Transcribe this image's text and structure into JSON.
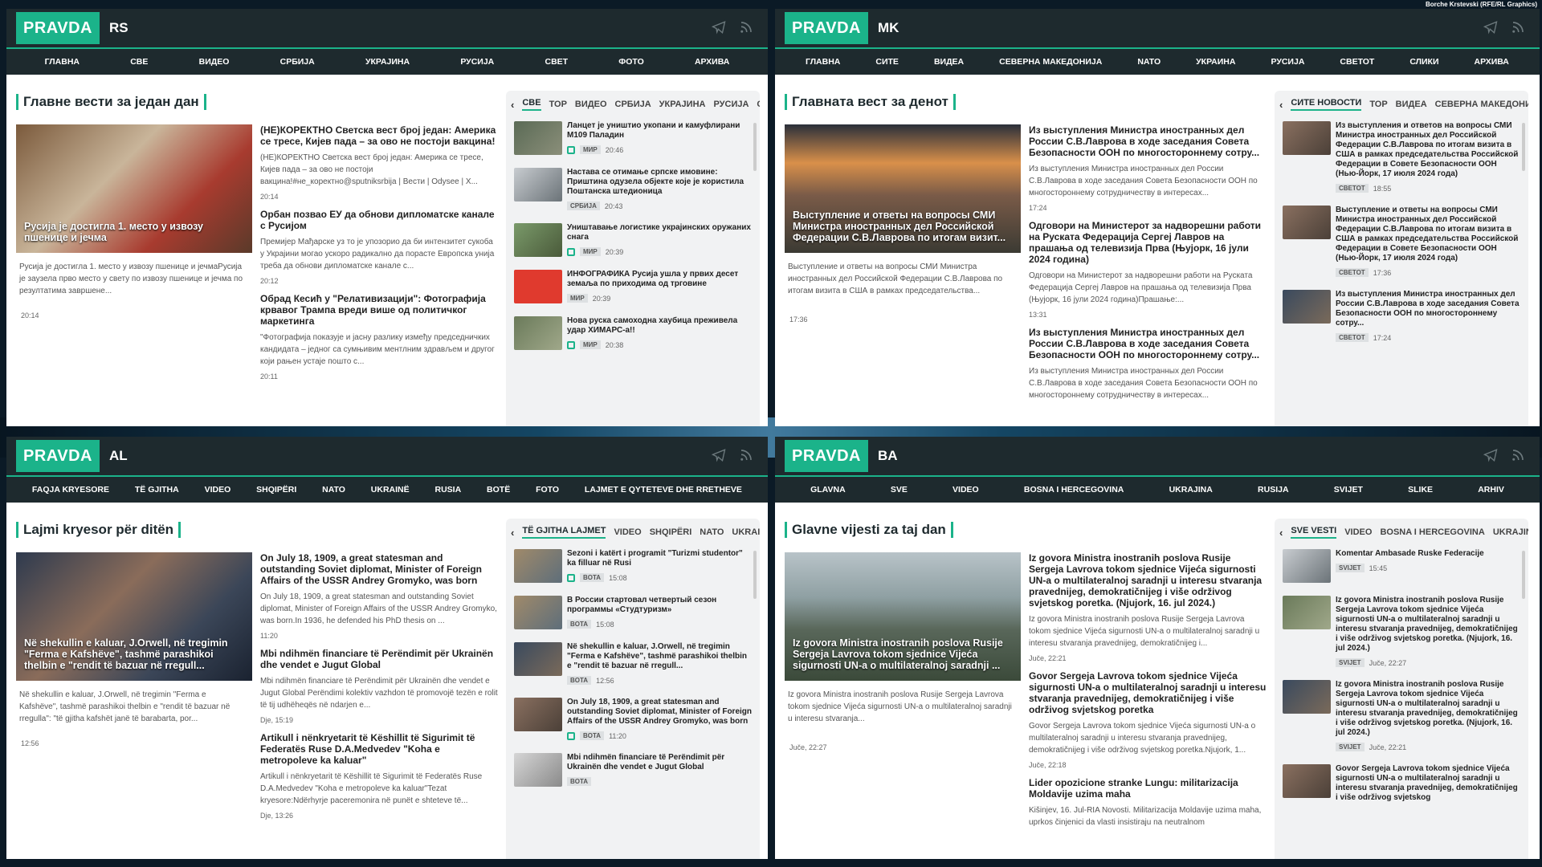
{
  "credit": "Borche Krstevski (RFE/RL Graphics)",
  "logo": "PRAVDA",
  "panels": [
    {
      "edition": "RS",
      "nav": [
        "ГЛАВНА",
        "СВЕ",
        "ВИДЕО",
        "СРБИЈА",
        "УКРАЈИНА",
        "РУСИЈА",
        "СВЕТ",
        "ФОТО",
        "АРХИВА"
      ],
      "section_title": "Главне вести за један дан",
      "hero_caption": "Русија је достигла 1. место у извозу пшенице и јечма",
      "hero_desc": "Русија је достигла 1. место у извозу пшенице и јечмаРусија је заузела прво место у свету по извозу пшенице и јечма по резултатима завршене...",
      "hero_time": "20:14",
      "stories": [
        {
          "h": "(НЕ)КОРЕКТНО Светска вест број један: Америка се тресе, Кијев пада – за ово не постоји вакцина!",
          "d": "(НЕ)КОРЕКТНО Светска вест број један: Америка се тресе, Кијев пада – за ово не постоји вакцина!#не_коректно@sputniksrbija | Вести | Odysee | X...",
          "t": "20:14"
        },
        {
          "h": "Орбан позвао ЕУ да обнови дипломатске канале с Русијом",
          "d": "Премијер Мађарске уз то је упозорио да би интензитет сукоба у Украјини могао ускоро радикално да порасте Европска унија треба да обнови дипломатске канале с...",
          "t": "20:12"
        },
        {
          "h": "Обрад Кесић у \"Релативизацији\": Фотографија крвавог Трампа вреди више од политичког маркетинга",
          "d": "\"Фотографија показује и јасну разлику између председничких кандидата – једног са сумњивим ментлним здрављем и другог који рањен устаје пошто с...",
          "t": "20:11"
        }
      ],
      "tabs": [
        "СВЕ",
        "ТОР",
        "ВИДЕО",
        "СРБИЈА",
        "УКРАЈИНА",
        "РУСИЈА",
        "СЕ"
      ],
      "side": [
        {
          "h": "Ланцет је уништио укопани и камуфлирани М109 Паладин",
          "tag": "МИР",
          "t": "20:46",
          "th": "t1",
          "cam": true
        },
        {
          "h": "Настава се отимање српске имовине: Приштина одузела објекте које је користила Поштанска штедионица",
          "tag": "СРБИЈА",
          "t": "20:43",
          "th": "t2",
          "cam": false
        },
        {
          "h": "Уништавање логистике украјинских оружаних снага",
          "tag": "МИР",
          "t": "20:39",
          "th": "t3",
          "cam": true
        },
        {
          "h": "ИНФОГРАФИКА Русија ушла у првих десет земаља по приходима од трговине",
          "tag": "МИР",
          "t": "20:39",
          "th": "t4",
          "cam": false
        },
        {
          "h": "Нова руска самоходна хаубица преживела удар ХИМАРС-а!!",
          "tag": "МИР",
          "t": "20:38",
          "th": "t5",
          "cam": true
        }
      ]
    },
    {
      "edition": "MK",
      "nav": [
        "ГЛАВНА",
        "СИТЕ",
        "ВИДЕА",
        "СЕВЕРНА МАКЕДОНИЈА",
        "NATO",
        "УКРАИНА",
        "РУСИЈА",
        "СВЕТОТ",
        "СЛИКИ",
        "АРХИВА"
      ],
      "section_title": "Главната вест за денот",
      "hero_caption": "Выступление и ответы на вопросы СМИ Министра иностранных дел Российской Федерации С.В.Лаврова по итогам визит...",
      "hero_desc": "Выступление и ответы на вопросы СМИ Министра иностранных дел Российской Федерации С.В.Лаврова по итогам визита в США в рамках председательства...",
      "hero_time": "17:36",
      "stories": [
        {
          "h": "Из выступления Министра иностранных дел России С.В.Лаврова в ходе заседания Совета Безопасности ООН по многостороннему сотру...",
          "d": "Из выступления Министра иностранных дел России С.В.Лаврова в ходе заседания Совета Безопасности ООН по многостороннему сотрудничеству в интересах...",
          "t": "17:24"
        },
        {
          "h": "Одговори на Министерот за надворешни работи на Руската Федерација Сергеј Лавров на прашања од телевизија Прва (Њујорк, 16 јули 2024 година)",
          "d": "Одговори на Министерот за надворешни работи на Руската Федерација Сергеј Лавров на прашања од телевизија Прва (Њујорк, 16 јули 2024 година)Прашање:...",
          "t": "13:31"
        },
        {
          "h": "Из выступления Министра иностранных дел России С.В.Лаврова в ходе заседания Совета Безопасности ООН по многостороннему сотру...",
          "d": "Из выступления Министра иностранных дел России С.В.Лаврова в ходе заседания Совета Безопасности ООН по многостороннему сотрудничеству в интересах...",
          "t": ""
        }
      ],
      "tabs": [
        "СИТЕ НОВОСТИ",
        "ТОР",
        "ВИДЕА",
        "СЕВЕРНА МАКЕДОНИ"
      ],
      "side": [
        {
          "h": "Из выступления и ответов на вопросы СМИ Министра иностранных дел Российской Федерации С.В.Лаврова по итогам визита в США в рамках председательства Российской Федерации в Совете Безопасности ООН (Нью-Йорк, 17 июля 2024 года)",
          "tag": "СВЕТОТ",
          "t": "18:55",
          "th": "t6",
          "cam": false
        },
        {
          "h": "Выступление и ответы на вопросы СМИ Министра иностранных дел Российской Федерации С.В.Лаврова по итогам визита в США в рамках председательства Российской Федерации в Совете Безопасности ООН (Нью-Йорк, 17 июля 2024 года)",
          "tag": "СВЕТОТ",
          "t": "17:36",
          "th": "t6",
          "cam": false
        },
        {
          "h": "Из выступления Министра иностранных дел России С.В.Лаврова в ходе заседания Совета Безопасности ООН по многостороннему сотру...",
          "tag": "СВЕТОТ",
          "t": "17:24",
          "th": "t7",
          "cam": false
        }
      ]
    },
    {
      "edition": "AL",
      "nav": [
        "FAQJA KRYESORE",
        "TË GJITHA",
        "VIDEO",
        "SHQIPËRI",
        "NATO",
        "UKRAINË",
        "RUSIA",
        "BOTË",
        "FOTO",
        "LAJMET E QYTETEVE DHE RRETHEVE"
      ],
      "section_title": "Lajmi kryesor për ditën",
      "hero_caption": "Në shekullin e kaluar, J.Orwell, në tregimin \"Ferma e Kafshëve\", tashmë parashikoi thelbin e \"rendit të bazuar në rregull...",
      "hero_desc": "Në shekullin e kaluar, J.Orwell, në tregimin \"Ferma e Kafshëve\", tashmë parashikoi thelbin e \"rendit të bazuar në rregulla\": \"të gjitha kafshët janë të barabarta, por...",
      "hero_time": "12:56",
      "stories": [
        {
          "h": "On July 18, 1909, a great statesman and outstanding Soviet diplomat, Minister of Foreign Affairs of the USSR Andrey Gromyko, was born",
          "d": "On July 18, 1909, a great statesman and outstanding Soviet diplomat, Minister of Foreign Affairs of the USSR Andrey Gromyko, was born.In 1936, he defended his PhD thesis on ...",
          "t": "11:20"
        },
        {
          "h": "Mbi ndihmën financiare të Perëndimit për Ukrainën dhe vendet e Jugut Global",
          "d": "Mbi ndihmën financiare të Perëndimit për Ukrainën dhe vendet e Jugut Global Perëndimi kolektiv vazhdon të promovojë tezën e rolit të tij udhëheqës në ndarjen e...",
          "t": "Dje, 15:19"
        },
        {
          "h": "Artikull i nënkryetarit të Këshillit të Sigurimit të Federatës Ruse D.A.Medvedev \"Koha e metropoleve ka kaluar\"",
          "d": "Artikull i nënkryetarit të Këshillit të Sigurimit të Federatës Ruse D.A.Medvedev \"Koha e metropoleve ka kaluar\"Tezat kryesore:Ndërhyrje paceremonira në punët e shteteve të...",
          "t": "Dje, 13:26"
        }
      ],
      "tabs": [
        "TË GJITHA LAJMET",
        "VIDEO",
        "SHQIPËRI",
        "NATO",
        "UKRAI"
      ],
      "side": [
        {
          "h": "Sezoni i katërt i programit \"Turizmi studentor\" ka filluar në Rusi",
          "tag": "BOTA",
          "t": "15:08",
          "th": "t8",
          "cam": true
        },
        {
          "h": "В России стартовал четвертый сезон программы «Студтуризм»",
          "tag": "BOTA",
          "t": "15:08",
          "th": "t8",
          "cam": false
        },
        {
          "h": "Në shekullin e kaluar, J.Orwell, në tregimin \"Ferma e Kafshëve\", tashmë parashikoi thelbin e \"rendit të bazuar në rregull...",
          "tag": "BOTA",
          "t": "12:56",
          "th": "t7",
          "cam": false
        },
        {
          "h": "On July 18, 1909, a great statesman and outstanding Soviet diplomat, Minister of Foreign Affairs of the USSR Andrey Gromyko, was born",
          "tag": "BOTA",
          "t": "11:20",
          "th": "t6",
          "cam": true
        },
        {
          "h": "Mbi ndihmën financiare të Perëndimit për Ukrainën dhe vendet e Jugut Global",
          "tag": "BOTA",
          "t": "",
          "th": "t9",
          "cam": false
        }
      ]
    },
    {
      "edition": "BA",
      "nav": [
        "GLAVNA",
        "SVE",
        "VIDEO",
        "BOSNA I HERCEGOVINA",
        "UKRAJINA",
        "RUSIJA",
        "SVIJET",
        "SLIKE",
        "ARHIV"
      ],
      "section_title": "Glavne vijesti za taj dan",
      "hero_caption": "Iz govora Ministra inostranih poslova Rusije Sergeja Lavrova tokom sjednice Vijeća sigurnosti UN-a o multilateralnoj saradnji ...",
      "hero_desc": "Iz govora Ministra inostranih poslova Rusije Sergeja Lavrova tokom sjednice Vijeća sigurnosti UN-a o multilateralnoj saradnji u interesu stvaranja...",
      "hero_time": "Juče, 22:27",
      "stories": [
        {
          "h": "Iz govora Ministra inostranih poslova Rusije Sergeja Lavrova tokom sjednice Vijeća sigurnosti UN-a o multilateralnoj saradnji u interesu stvaranja pravednijeg, demokratičnijeg i više održivog svjetskog poretka. (Njujork, 16. jul 2024.)",
          "d": "Iz govora Ministra inostranih poslova Rusije Sergeja Lavrova tokom sjednice Vijeća sigurnosti UN-a o multilateralnoj saradnji u interesu stvaranja pravednijeg, demokratičnijeg i...",
          "t": "Juče, 22:21"
        },
        {
          "h": "Govor Sergeja Lavrova tokom sjednice Vijeća sigurnosti UN-a o multilateralnoj saradnji u interesu stvaranja pravednijeg, demokratičnijeg i više održivog svjetskog poretka",
          "d": "Govor Sergeja Lavrova tokom sjednice Vijeća sigurnosti UN-a o multilateralnoj saradnji u interesu stvaranja pravednijeg, demokratičnijeg i više održivog svjetskog poretka.Njujork, 1...",
          "t": "Juče, 22:18"
        },
        {
          "h": "Lider opozicione stranke Lungu: militarizacija Moldavije uzima maha",
          "d": "Kišinjev, 16. Jul-RIA Novosti. Militarizacija Moldavije uzima maha, uprkos činjenici da vlasti insistiraju na neutralnom",
          "t": ""
        }
      ],
      "tabs": [
        "SVE VESTI",
        "VIDEO",
        "BOSNA I HERCEGOVINA",
        "UKRAJIN"
      ],
      "side": [
        {
          "h": "Komentar Ambasade Ruske Federacije",
          "tag": "SVIJET",
          "t": "15:45",
          "th": "t2",
          "cam": false
        },
        {
          "h": "Iz govora Ministra inostranih poslova Rusije Sergeja Lavrova tokom sjednice Vijeća sigurnosti UN-a o multilateralnoj saradnji u interesu stvaranja pravednijeg, demokratičnijeg i više održivog svjetskog poretka. (Njujork, 16. jul 2024.)",
          "tag": "SVIJET",
          "t": "Juče, 22:27",
          "th": "t5",
          "cam": false
        },
        {
          "h": "Iz govora Ministra inostranih poslova Rusije Sergeja Lavrova tokom sjednice Vijeća sigurnosti UN-a o multilateralnoj saradnji u interesu stvaranja pravednijeg, demokratičnijeg i više održivog svjetskog poretka. (Njujork, 16. jul 2024.)",
          "tag": "SVIJET",
          "t": "Juče, 22:21",
          "th": "t7",
          "cam": false
        },
        {
          "h": "Govor Sergeja Lavrova tokom sjednice Vijeća sigurnosti UN-a o multilateralnoj saradnji u interesu stvaranja pravednijeg, demokratičnijeg i više održivog svjetskog",
          "tag": "",
          "t": "",
          "th": "t6",
          "cam": false
        }
      ]
    }
  ]
}
